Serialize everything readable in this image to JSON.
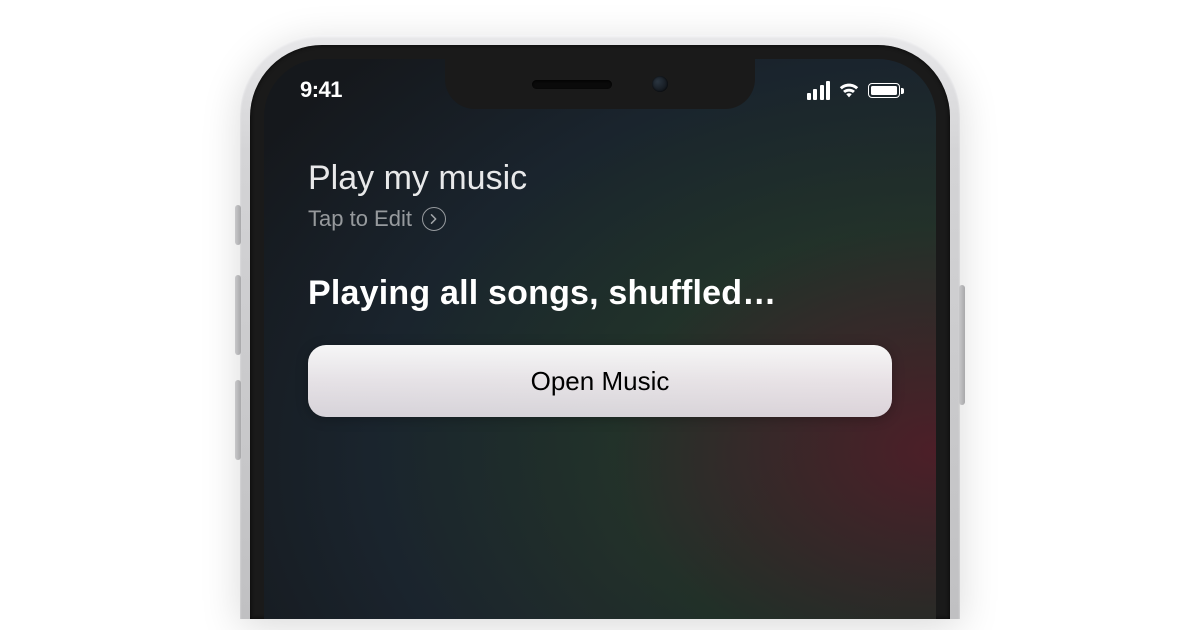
{
  "status": {
    "time": "9:41"
  },
  "siri": {
    "query": "Play my music",
    "edit_label": "Tap to Edit",
    "response": "Playing all songs, shuffled…",
    "action_button_label": "Open Music"
  }
}
